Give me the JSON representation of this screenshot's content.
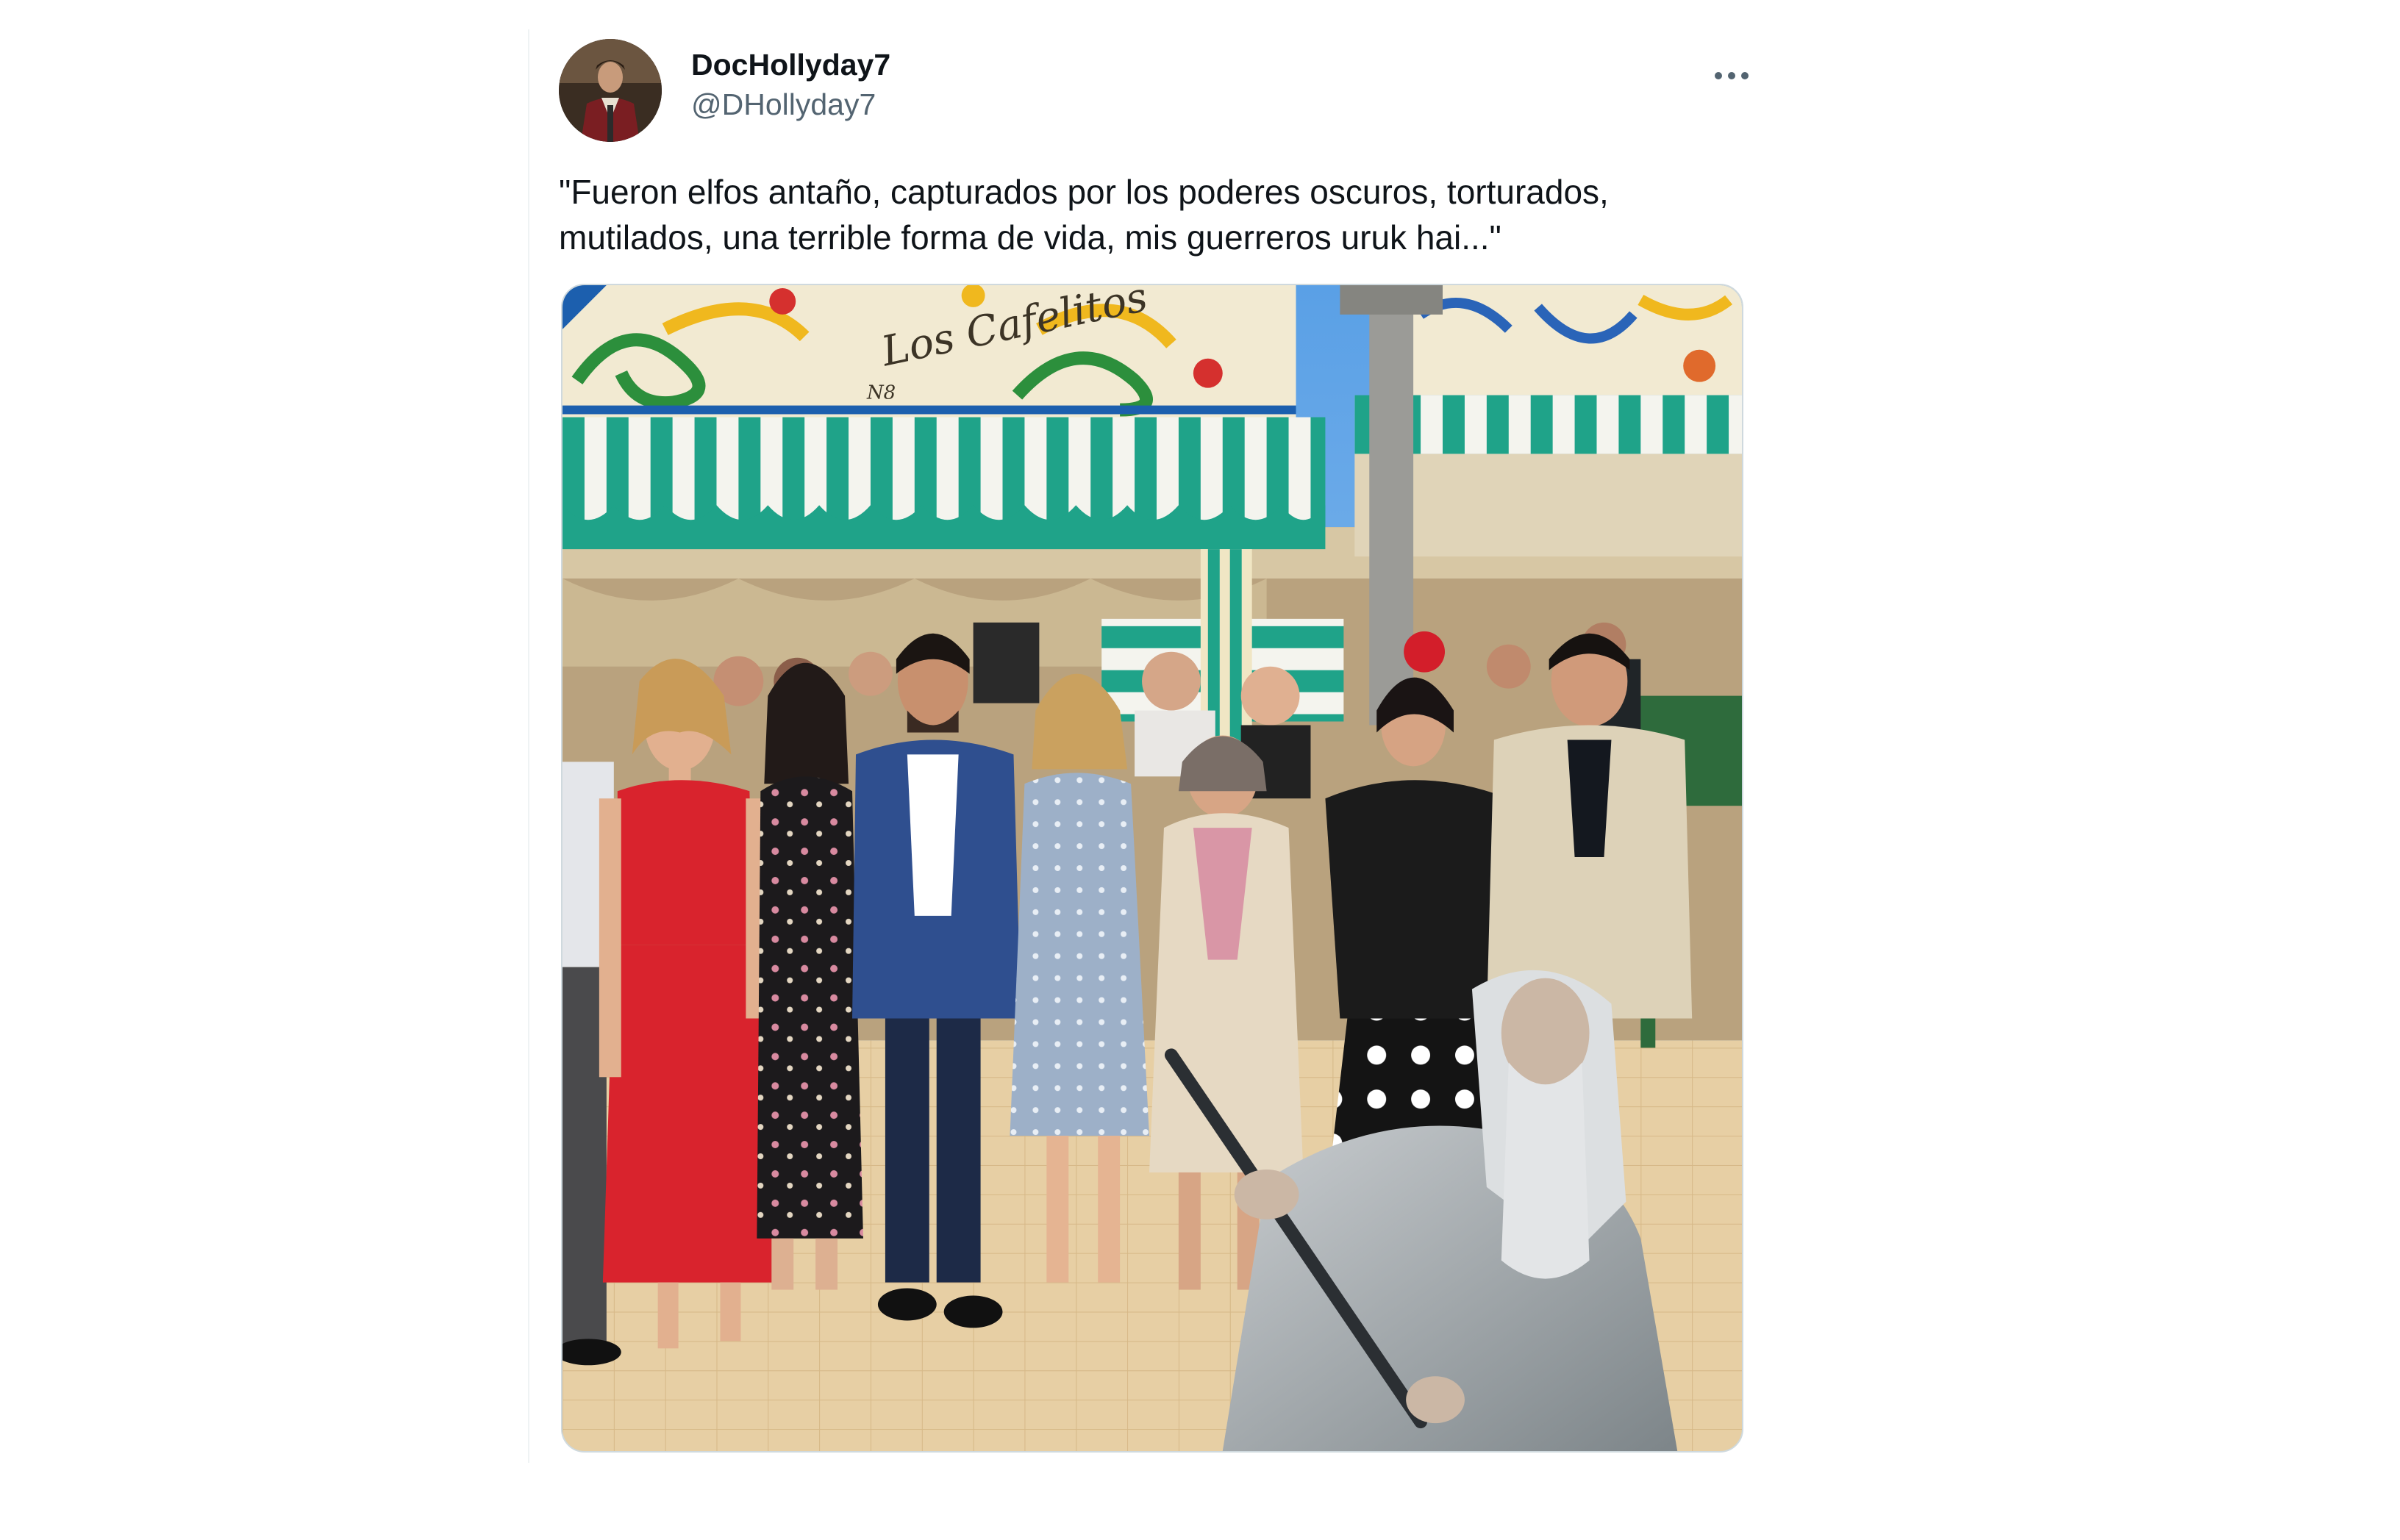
{
  "tweet": {
    "author": {
      "display_name": "DocHollyday7",
      "handle": "@DHollyday7"
    },
    "more_icon": "more-horizontal-icon",
    "text": "\"Fueron elfos antaño, capturados por los poderes oscuros, torturados,\nmutilados, una terrible forma de vida, mis guerreros uruk hai...\"",
    "media": {
      "sign_text": "Los Cafelitos",
      "sign_number": "N8"
    }
  },
  "colors": {
    "text_primary": "#0f1419",
    "text_secondary": "#536471",
    "awning_green": "#1fa389",
    "dress_red": "#d9232d"
  }
}
